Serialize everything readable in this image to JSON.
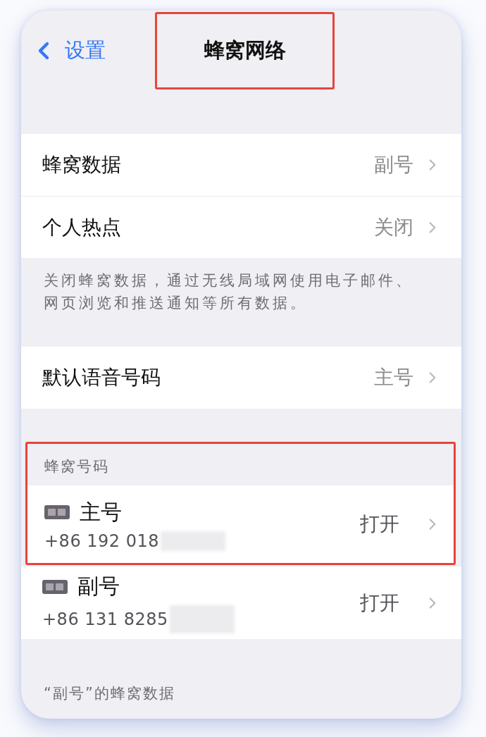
{
  "nav": {
    "back_label": "设置",
    "title": "蜂窝网络",
    "title_highlighted": true
  },
  "groups": [
    {
      "rows": [
        {
          "label": "蜂窝数据",
          "value": "副号"
        },
        {
          "label": "个人热点",
          "value": "关闭"
        }
      ],
      "footer": "关闭蜂窝数据，通过无线局域网使用电子邮件、网页浏览和推送通知等所有数据。"
    },
    {
      "rows": [
        {
          "label": "默认语音号码",
          "value": "主号"
        }
      ]
    }
  ],
  "sim_section": {
    "header": "蜂窝号码",
    "lines": [
      {
        "name": "主号",
        "number": "+86 192 018",
        "status": "打开",
        "highlighted": true,
        "redacted": true
      },
      {
        "name": "副号",
        "number": "+86 131 8285",
        "status": "打开",
        "highlighted": false,
        "redacted": true
      }
    ]
  },
  "next_section": {
    "header": "“副号”的蜂窝数据"
  }
}
